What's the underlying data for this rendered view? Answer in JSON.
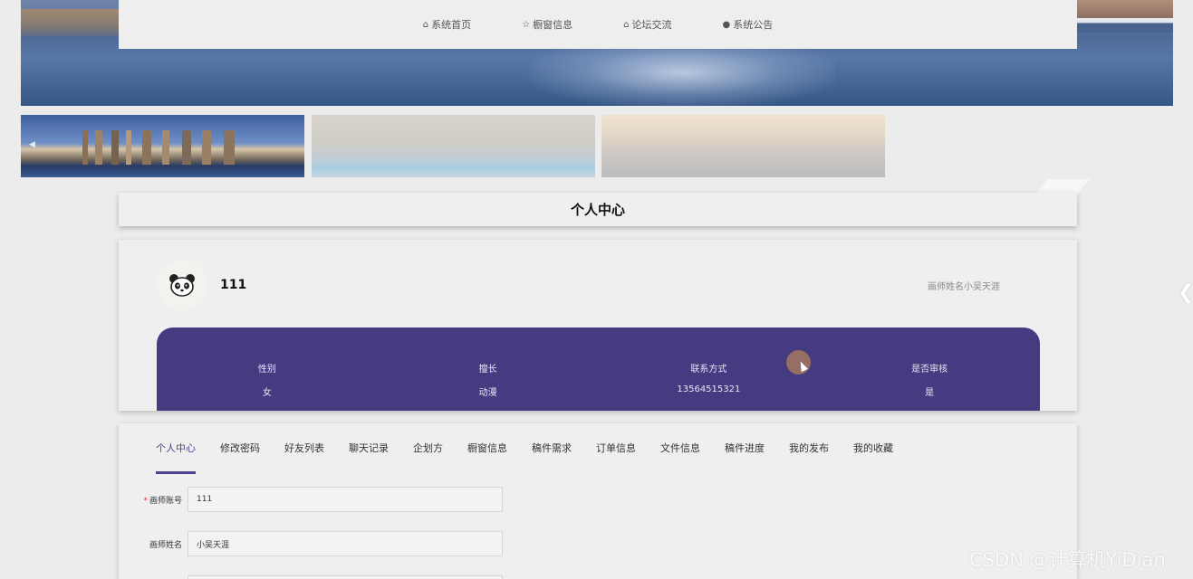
{
  "nav": {
    "items": [
      {
        "label": "系统首页",
        "icon": "home-icon",
        "glyph": "⌂"
      },
      {
        "label": "橱窗信息",
        "icon": "star-icon",
        "glyph": "☆"
      },
      {
        "label": "论坛交流",
        "icon": "bag-icon",
        "glyph": "⌂"
      },
      {
        "label": "系统公告",
        "icon": "info-icon",
        "glyph": "●"
      }
    ]
  },
  "page_title": "个人中心",
  "profile": {
    "username": "111",
    "name_text": "画师姓名小吴天涯",
    "avatar_icon": "panda-icon",
    "fields": [
      {
        "label": "性别",
        "value": "女"
      },
      {
        "label": "擅长",
        "value": "动漫"
      },
      {
        "label": "联系方式",
        "value": "13564515321"
      },
      {
        "label": "是否审核",
        "value": "是"
      }
    ]
  },
  "tabs": [
    "个人中心",
    "修改密码",
    "好友列表",
    "聊天记录",
    "企划方",
    "橱窗信息",
    "稿件需求",
    "订单信息",
    "文件信息",
    "稿件进度",
    "我的发布",
    "我的收藏"
  ],
  "active_tab": "个人中心",
  "form": {
    "account_label": "画师账号",
    "account_value": "111",
    "name_label": "画师姓名",
    "name_value": "小吴天涯"
  },
  "watermark": "CSDN @计算机YiDian",
  "colors": {
    "accent": "#443b80",
    "tab_active": "#4b4290"
  }
}
